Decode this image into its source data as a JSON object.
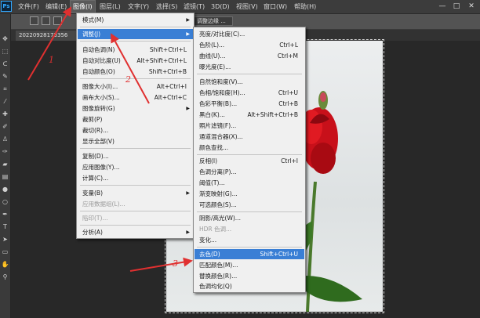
{
  "app": {
    "logo": "Ps"
  },
  "menubar": {
    "items": [
      {
        "label": "文件(F)"
      },
      {
        "label": "编辑(E)"
      },
      {
        "label": "图像(I)"
      },
      {
        "label": "图层(L)"
      },
      {
        "label": "文字(Y)"
      },
      {
        "label": "选择(S)"
      },
      {
        "label": "滤镜(T)"
      },
      {
        "label": "3D(D)"
      },
      {
        "label": "视图(V)"
      },
      {
        "label": "窗口(W)"
      },
      {
        "label": "帮助(H)"
      }
    ],
    "window_controls": [
      "—",
      "□",
      "✕"
    ]
  },
  "options_bar": {
    "adjust_edge_label": "调整边缘 ..."
  },
  "tab": {
    "title": "20220928173356"
  },
  "image_menu": {
    "items": [
      {
        "label": "模式(M)",
        "shortcut": "",
        "submenu": true
      },
      {
        "label": "调整(J)",
        "shortcut": "",
        "submenu": true,
        "highlighted": true
      },
      {
        "label": "自动色调(N)",
        "shortcut": "Shift+Ctrl+L"
      },
      {
        "label": "自动对比度(U)",
        "shortcut": "Alt+Shift+Ctrl+L"
      },
      {
        "label": "自动颜色(O)",
        "shortcut": "Shift+Ctrl+B"
      },
      {
        "label": "图像大小(I)...",
        "shortcut": "Alt+Ctrl+I"
      },
      {
        "label": "画布大小(S)...",
        "shortcut": "Alt+Ctrl+C"
      },
      {
        "label": "图像旋转(G)",
        "shortcut": "",
        "submenu": true
      },
      {
        "label": "裁剪(P)",
        "shortcut": ""
      },
      {
        "label": "裁切(R)...",
        "shortcut": ""
      },
      {
        "label": "显示全部(V)",
        "shortcut": ""
      },
      {
        "label": "复制(D)...",
        "shortcut": ""
      },
      {
        "label": "应用图像(Y)...",
        "shortcut": ""
      },
      {
        "label": "计算(C)...",
        "shortcut": ""
      },
      {
        "label": "变量(B)",
        "shortcut": "",
        "submenu": true
      },
      {
        "label": "应用数据组(L)...",
        "shortcut": "",
        "disabled": true
      },
      {
        "label": "陷印(T)...",
        "shortcut": "",
        "disabled": true
      },
      {
        "label": "分析(A)",
        "shortcut": "",
        "submenu": true
      }
    ]
  },
  "adjust_menu": {
    "items": [
      {
        "label": "亮度/对比度(C)...",
        "shortcut": ""
      },
      {
        "label": "色阶(L)...",
        "shortcut": "Ctrl+L"
      },
      {
        "label": "曲线(U)...",
        "shortcut": "Ctrl+M"
      },
      {
        "label": "曝光度(E)...",
        "shortcut": ""
      },
      {
        "label": "自然饱和度(V)...",
        "shortcut": ""
      },
      {
        "label": "色相/饱和度(H)...",
        "shortcut": "Ctrl+U"
      },
      {
        "label": "色彩平衡(B)...",
        "shortcut": "Ctrl+B"
      },
      {
        "label": "黑白(K)...",
        "shortcut": "Alt+Shift+Ctrl+B"
      },
      {
        "label": "照片滤镜(F)...",
        "shortcut": ""
      },
      {
        "label": "通道混合器(X)...",
        "shortcut": ""
      },
      {
        "label": "颜色查找...",
        "shortcut": ""
      },
      {
        "label": "反相(I)",
        "shortcut": "Ctrl+I"
      },
      {
        "label": "色调分离(P)...",
        "shortcut": ""
      },
      {
        "label": "阈值(T)...",
        "shortcut": ""
      },
      {
        "label": "渐变映射(G)...",
        "shortcut": ""
      },
      {
        "label": "可选颜色(S)...",
        "shortcut": ""
      },
      {
        "label": "阴影/高光(W)...",
        "shortcut": ""
      },
      {
        "label": "HDR 色调...",
        "shortcut": "",
        "disabled": true
      },
      {
        "label": "变化...",
        "shortcut": ""
      },
      {
        "label": "去色(D)",
        "shortcut": "Shift+Ctrl+U",
        "highlighted": true
      },
      {
        "label": "匹配颜色(M)...",
        "shortcut": ""
      },
      {
        "label": "替换颜色(R)...",
        "shortcut": ""
      },
      {
        "label": "色调均化(Q)",
        "shortcut": ""
      }
    ]
  },
  "annotations": [
    "1",
    "2",
    "3"
  ],
  "colors": {
    "highlight": "#3a7fd5",
    "annotation": "#e03030"
  }
}
